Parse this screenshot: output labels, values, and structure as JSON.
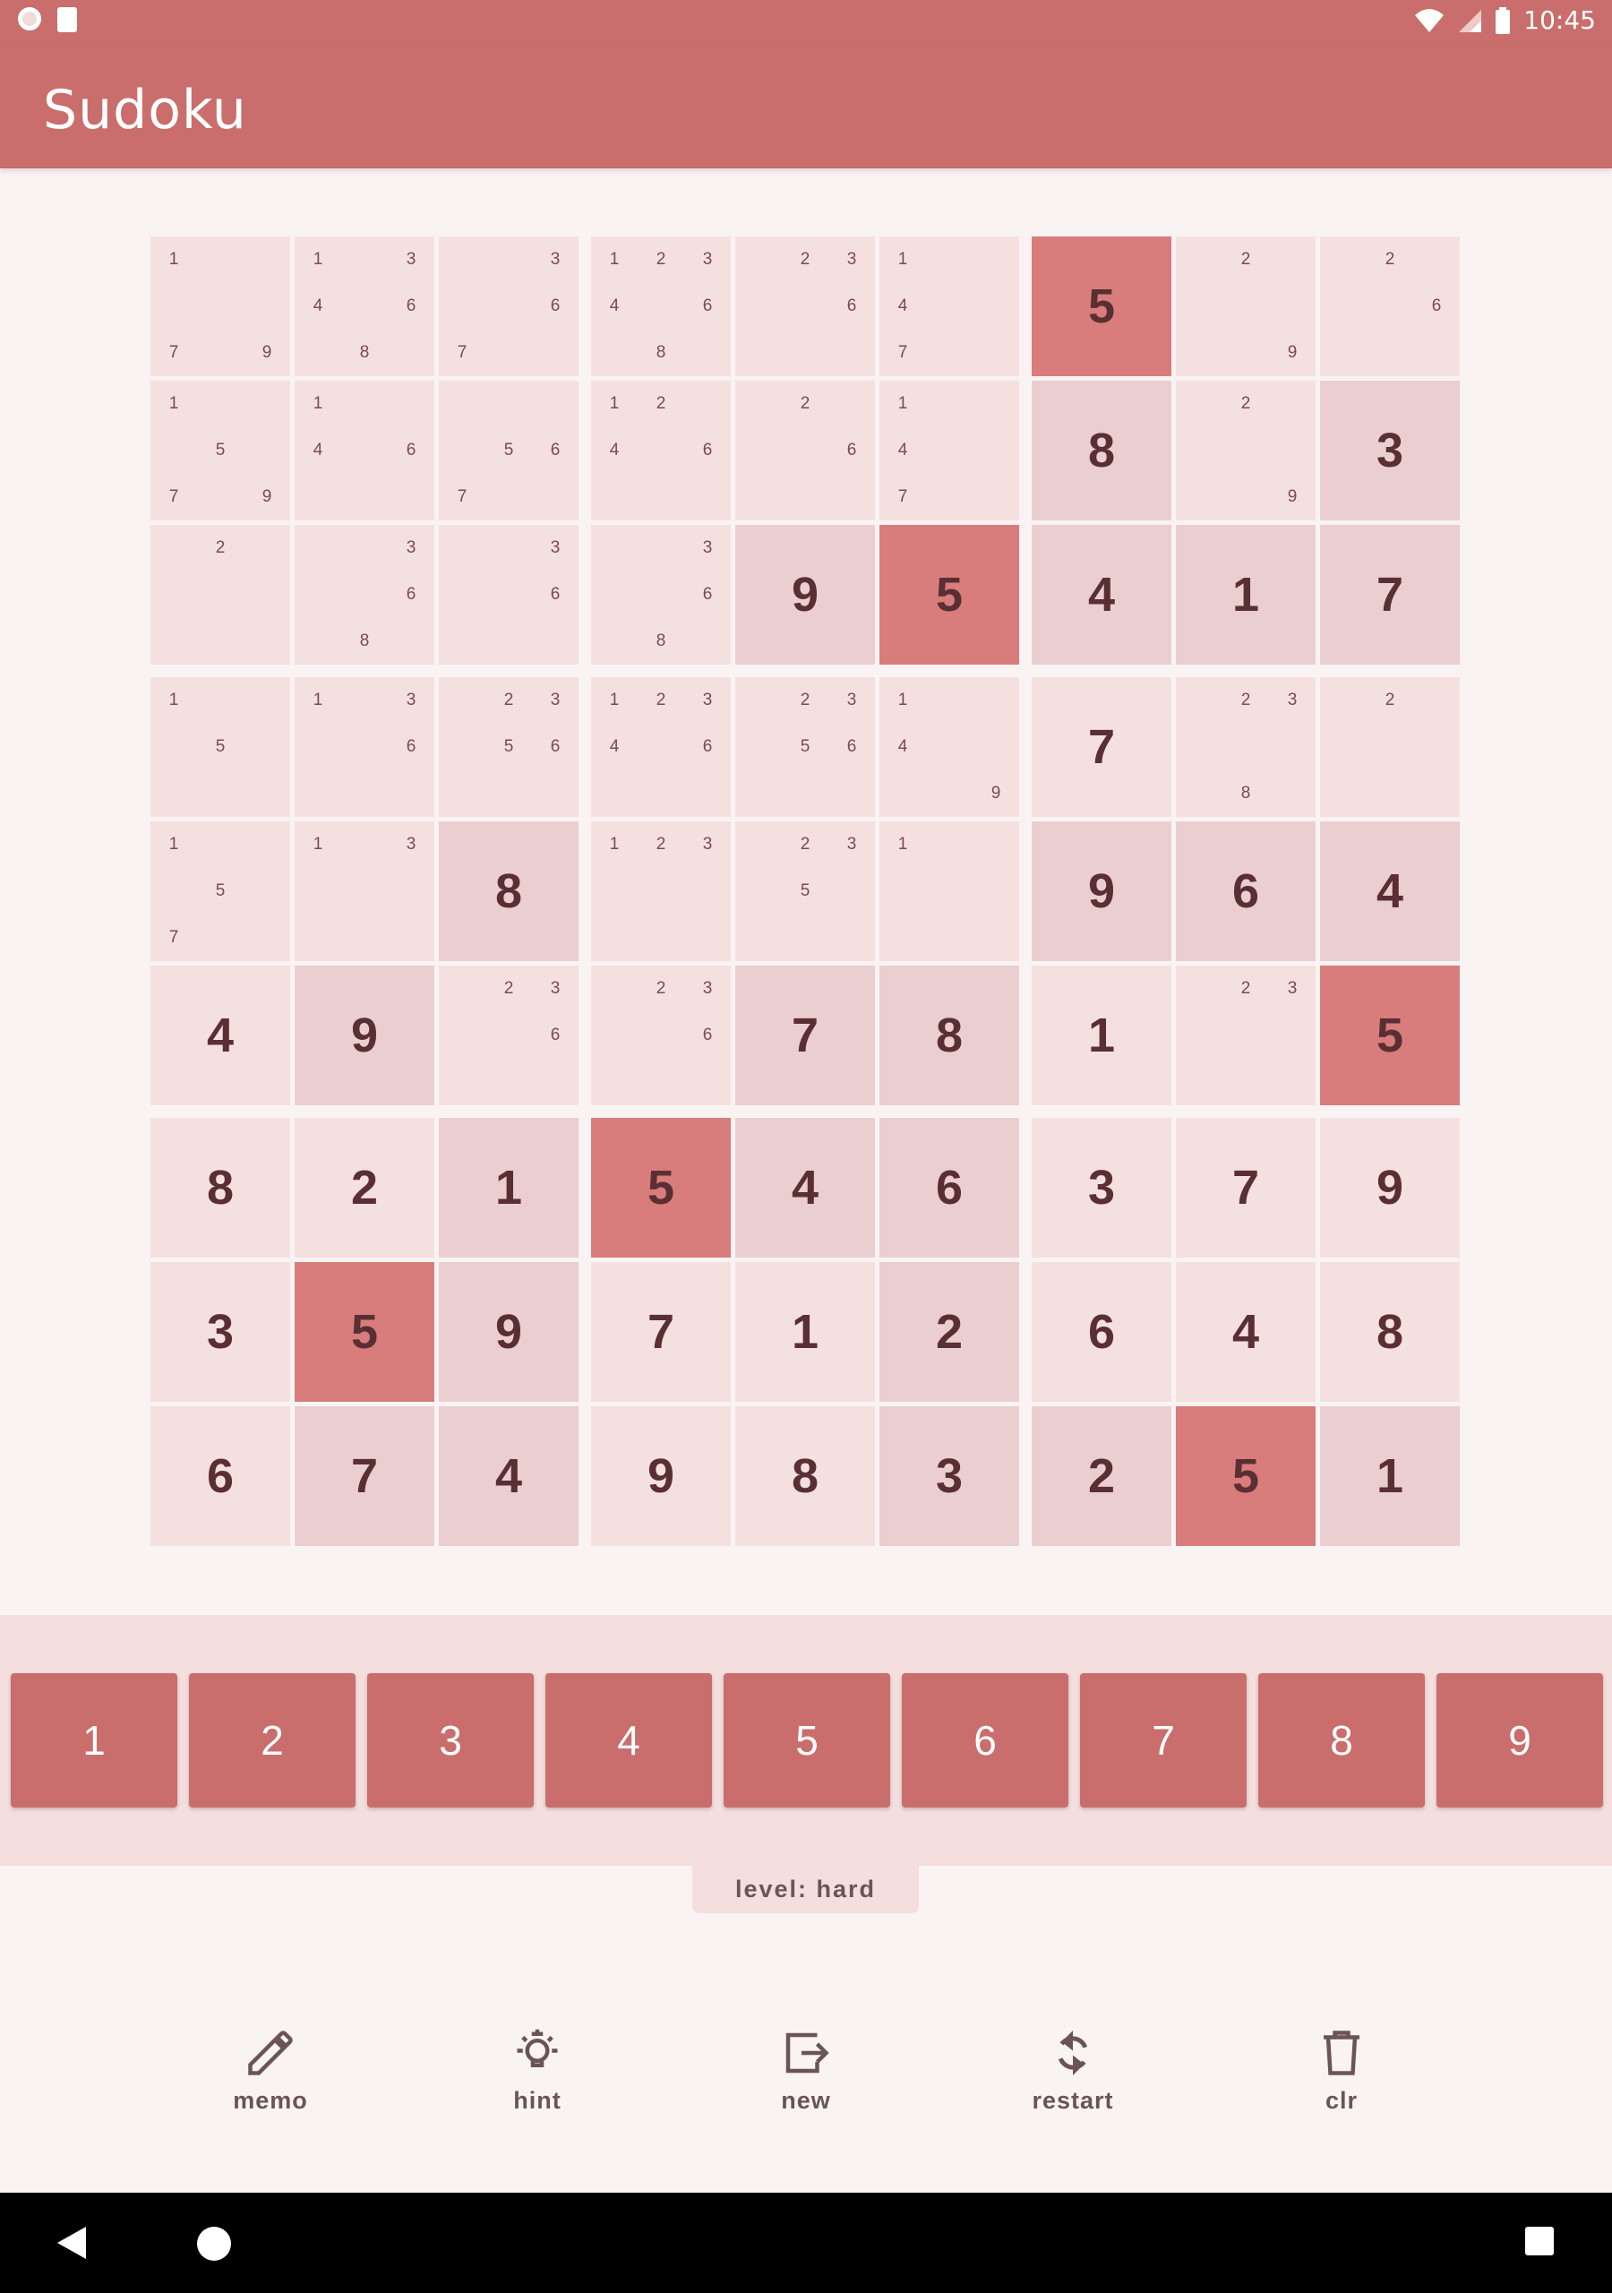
{
  "status_bar": {
    "time": "10:45"
  },
  "app": {
    "title": "Sudoku"
  },
  "board": {
    "cells": [
      [
        {
          "v": "",
          "n": [
            1,
            7,
            9
          ],
          "s": ""
        },
        {
          "v": "",
          "n": [
            1,
            3,
            4,
            6,
            8
          ],
          "s": ""
        },
        {
          "v": "",
          "n": [
            3,
            6,
            7
          ],
          "s": ""
        },
        {
          "v": "",
          "n": [
            1,
            2,
            3,
            4,
            6,
            8
          ],
          "s": ""
        },
        {
          "v": "",
          "n": [
            2,
            3,
            6
          ],
          "s": ""
        },
        {
          "v": "",
          "n": [
            1,
            4,
            7
          ],
          "s": ""
        },
        {
          "v": "5",
          "n": [],
          "s": "hl"
        },
        {
          "v": "",
          "n": [
            2,
            9
          ],
          "s": ""
        },
        {
          "v": "",
          "n": [
            2,
            6
          ],
          "s": ""
        }
      ],
      [
        {
          "v": "",
          "n": [
            1,
            5,
            7,
            9
          ],
          "s": ""
        },
        {
          "v": "",
          "n": [
            1,
            4,
            6
          ],
          "s": ""
        },
        {
          "v": "",
          "n": [
            5,
            6,
            7
          ],
          "s": ""
        },
        {
          "v": "",
          "n": [
            1,
            2,
            4,
            6
          ],
          "s": ""
        },
        {
          "v": "",
          "n": [
            2,
            6
          ],
          "s": ""
        },
        {
          "v": "",
          "n": [
            1,
            4,
            7
          ],
          "s": ""
        },
        {
          "v": "8",
          "n": [],
          "s": "given"
        },
        {
          "v": "",
          "n": [
            2,
            9
          ],
          "s": ""
        },
        {
          "v": "3",
          "n": [],
          "s": "given"
        }
      ],
      [
        {
          "v": "",
          "n": [
            2
          ],
          "s": ""
        },
        {
          "v": "",
          "n": [
            3,
            6,
            8
          ],
          "s": ""
        },
        {
          "v": "",
          "n": [
            3,
            6
          ],
          "s": ""
        },
        {
          "v": "",
          "n": [
            3,
            6,
            8
          ],
          "s": ""
        },
        {
          "v": "9",
          "n": [],
          "s": "given"
        },
        {
          "v": "5",
          "n": [],
          "s": "hl"
        },
        {
          "v": "4",
          "n": [],
          "s": "given"
        },
        {
          "v": "1",
          "n": [],
          "s": "given"
        },
        {
          "v": "7",
          "n": [],
          "s": "given"
        }
      ],
      [
        {
          "v": "",
          "n": [
            1,
            5
          ],
          "s": ""
        },
        {
          "v": "",
          "n": [
            1,
            3,
            6
          ],
          "s": ""
        },
        {
          "v": "",
          "n": [
            2,
            3,
            5,
            6
          ],
          "s": ""
        },
        {
          "v": "",
          "n": [
            1,
            2,
            3,
            4,
            6
          ],
          "s": ""
        },
        {
          "v": "",
          "n": [
            2,
            3,
            5,
            6
          ],
          "s": ""
        },
        {
          "v": "",
          "n": [
            1,
            4,
            9
          ],
          "s": ""
        },
        {
          "v": "7",
          "n": [],
          "s": ""
        },
        {
          "v": "",
          "n": [
            2,
            3,
            8
          ],
          "s": ""
        },
        {
          "v": "",
          "n": [
            2
          ],
          "s": ""
        }
      ],
      [
        {
          "v": "",
          "n": [
            1,
            5,
            7
          ],
          "s": ""
        },
        {
          "v": "",
          "n": [
            1,
            3
          ],
          "s": ""
        },
        {
          "v": "8",
          "n": [],
          "s": "given"
        },
        {
          "v": "",
          "n": [
            1,
            2,
            3
          ],
          "s": ""
        },
        {
          "v": "",
          "n": [
            2,
            3,
            5
          ],
          "s": ""
        },
        {
          "v": "",
          "n": [
            1
          ],
          "s": ""
        },
        {
          "v": "9",
          "n": [],
          "s": "given"
        },
        {
          "v": "6",
          "n": [],
          "s": "given"
        },
        {
          "v": "4",
          "n": [],
          "s": "given"
        }
      ],
      [
        {
          "v": "4",
          "n": [],
          "s": ""
        },
        {
          "v": "9",
          "n": [],
          "s": "given"
        },
        {
          "v": "",
          "n": [
            2,
            3,
            6
          ],
          "s": ""
        },
        {
          "v": "",
          "n": [
            2,
            3,
            6
          ],
          "s": ""
        },
        {
          "v": "7",
          "n": [],
          "s": "given"
        },
        {
          "v": "8",
          "n": [],
          "s": "given"
        },
        {
          "v": "1",
          "n": [],
          "s": ""
        },
        {
          "v": "",
          "n": [
            2,
            3
          ],
          "s": ""
        },
        {
          "v": "5",
          "n": [],
          "s": "hl"
        }
      ],
      [
        {
          "v": "8",
          "n": [],
          "s": ""
        },
        {
          "v": "2",
          "n": [],
          "s": ""
        },
        {
          "v": "1",
          "n": [],
          "s": "given"
        },
        {
          "v": "5",
          "n": [],
          "s": "hl"
        },
        {
          "v": "4",
          "n": [],
          "s": "given"
        },
        {
          "v": "6",
          "n": [],
          "s": "given"
        },
        {
          "v": "3",
          "n": [],
          "s": ""
        },
        {
          "v": "7",
          "n": [],
          "s": ""
        },
        {
          "v": "9",
          "n": [],
          "s": ""
        }
      ],
      [
        {
          "v": "3",
          "n": [],
          "s": ""
        },
        {
          "v": "5",
          "n": [],
          "s": "hl"
        },
        {
          "v": "9",
          "n": [],
          "s": "given"
        },
        {
          "v": "7",
          "n": [],
          "s": ""
        },
        {
          "v": "1",
          "n": [],
          "s": ""
        },
        {
          "v": "2",
          "n": [],
          "s": "given"
        },
        {
          "v": "6",
          "n": [],
          "s": ""
        },
        {
          "v": "4",
          "n": [],
          "s": ""
        },
        {
          "v": "8",
          "n": [],
          "s": ""
        }
      ],
      [
        {
          "v": "6",
          "n": [],
          "s": ""
        },
        {
          "v": "7",
          "n": [],
          "s": "given"
        },
        {
          "v": "4",
          "n": [],
          "s": "given"
        },
        {
          "v": "9",
          "n": [],
          "s": ""
        },
        {
          "v": "8",
          "n": [],
          "s": ""
        },
        {
          "v": "3",
          "n": [],
          "s": "given"
        },
        {
          "v": "2",
          "n": [],
          "s": "given"
        },
        {
          "v": "5",
          "n": [],
          "s": "hl"
        },
        {
          "v": "1",
          "n": [],
          "s": "given"
        }
      ]
    ]
  },
  "number_pad": [
    "1",
    "2",
    "3",
    "4",
    "5",
    "6",
    "7",
    "8",
    "9"
  ],
  "level_label": "level: hard",
  "toolbar": {
    "memo": "memo",
    "hint": "hint",
    "new": "new",
    "restart": "restart",
    "clear": "clr"
  },
  "colors": {
    "primary": "#c96e6c",
    "cell": "#f5e0e0",
    "cell_given": "#ebcfd0",
    "cell_highlight": "#d87c7c",
    "digit": "#5a2f33"
  }
}
